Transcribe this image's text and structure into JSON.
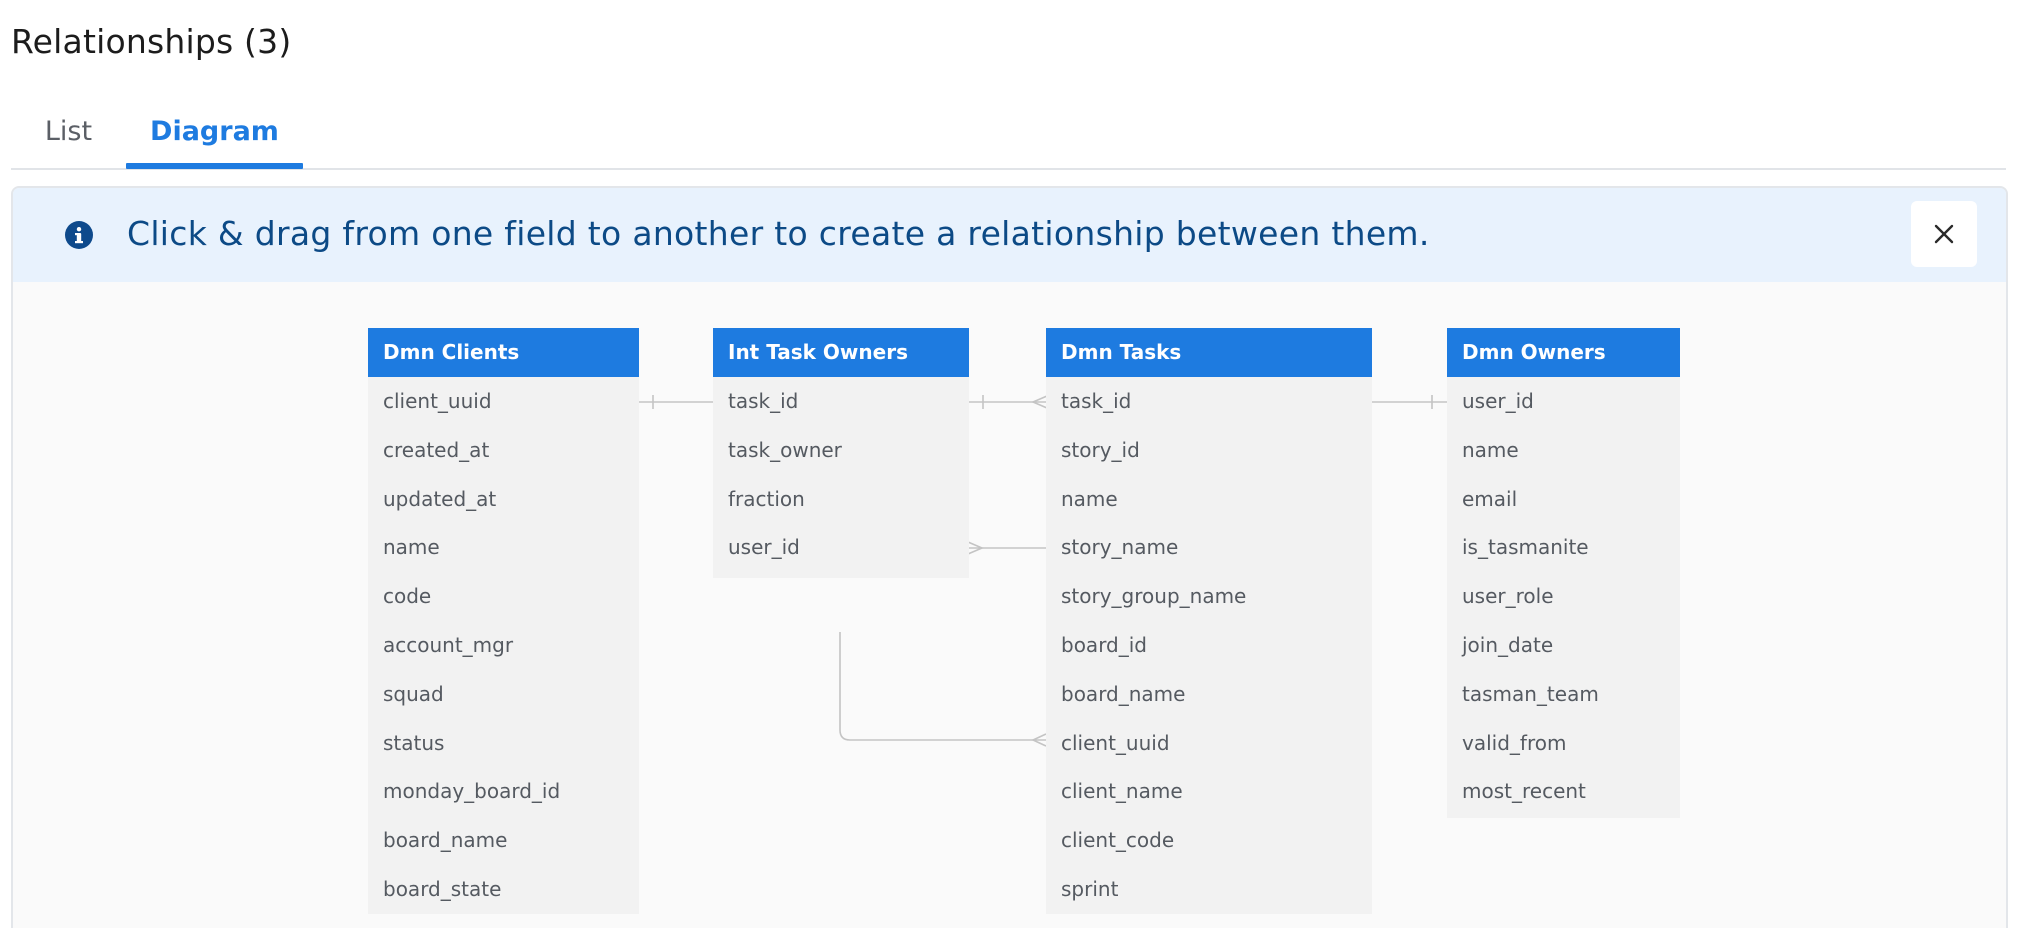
{
  "page": {
    "title": "Relationships (3)"
  },
  "tabs": [
    {
      "label": "List",
      "active": false
    },
    {
      "label": "Diagram",
      "active": true
    }
  ],
  "banner": {
    "icon": "info-icon",
    "text": "Click & drag from one field to another to create a relationship between them.",
    "close_icon": "close-icon"
  },
  "colors": {
    "accent": "#1e7be0",
    "banner_bg": "#e8f2fd",
    "banner_text": "#0c4a86",
    "entity_bg": "#f2f2f2",
    "connector": "#c4c4c4"
  },
  "entities": [
    {
      "id": "dmn-clients",
      "name": "Dmn Clients",
      "fields": [
        "client_uuid",
        "created_at",
        "updated_at",
        "name",
        "code",
        "account_mgr",
        "squad",
        "status",
        "monday_board_id",
        "board_name",
        "board_state"
      ]
    },
    {
      "id": "int-task-owners",
      "name": "Int Task Owners",
      "fields": [
        "task_id",
        "task_owner",
        "fraction",
        "user_id"
      ]
    },
    {
      "id": "dmn-tasks",
      "name": "Dmn Tasks",
      "fields": [
        "task_id",
        "story_id",
        "name",
        "story_name",
        "story_group_name",
        "board_id",
        "board_name",
        "client_uuid",
        "client_name",
        "client_code",
        "sprint"
      ]
    },
    {
      "id": "dmn-owners",
      "name": "Dmn Owners",
      "fields": [
        "user_id",
        "name",
        "email",
        "is_tasmanite",
        "user_role",
        "join_date",
        "tasman_team",
        "valid_from",
        "most_recent"
      ]
    }
  ],
  "relationships": [
    {
      "from": "dmn-clients.client_uuid",
      "to": "dmn-tasks.client_uuid",
      "cardinality": "one-to-many"
    },
    {
      "from": "int-task-owners.task_id",
      "to": "dmn-tasks.task_id",
      "cardinality": "one-to-many"
    },
    {
      "from": "dmn-owners.user_id",
      "to": "int-task-owners.user_id",
      "cardinality": "one-to-many"
    }
  ]
}
